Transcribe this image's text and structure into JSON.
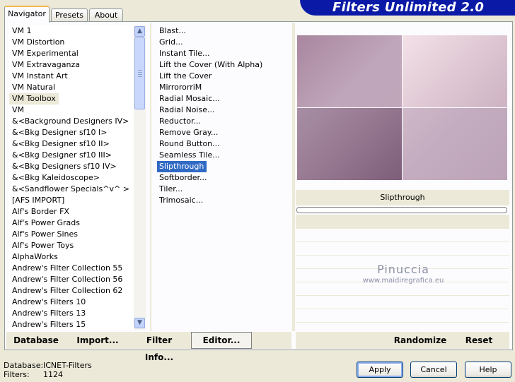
{
  "tabs": [
    "Navigator",
    "Presets",
    "About"
  ],
  "app_title": "Filters Unlimited 2.0",
  "categories": [
    "VM 1",
    "VM Distortion",
    "VM Experimental",
    "VM Extravaganza",
    "VM Instant Art",
    "VM Natural",
    "VM Toolbox",
    "VM",
    "&<Background Designers IV>",
    "&<Bkg Designer sf10 I>",
    "&<Bkg Designer sf10 II>",
    "&<Bkg Designer sf10 III>",
    "&<Bkg Designers sf10 IV>",
    "&<Bkg Kaleidoscope>",
    "&<Sandflower Specials^v^ >",
    "[AFS IMPORT]",
    "Alf's Border FX",
    "Alf's Power Grads",
    "Alf's Power Sines",
    "Alf's Power Toys",
    "AlphaWorks",
    "Andrew's Filter Collection 55",
    "Andrew's Filter Collection 56",
    "Andrew's Filter Collection 62",
    "Andrew's Filters 10",
    "Andrew's Filters 13",
    "Andrew's Filters 15"
  ],
  "filters": [
    "Blast...",
    "Grid...",
    "Instant Tile...",
    "Lift the Cover (With Alpha)",
    "Lift the Cover",
    "MirrororriM",
    "Radial Mosaic...",
    "Radial Noise...",
    "Reductor...",
    "Remove Gray...",
    "Round Button...",
    "Seamless Tile...",
    "Slipthrough",
    "Softborder...",
    "Tiler...",
    "Trimosaic..."
  ],
  "selected_filter": "Slipthrough",
  "progress_fraction": 0.0,
  "watermark": {
    "line1": "Pinuccia",
    "line2": "www.maidiregrafica.eu"
  },
  "toolbar": {
    "database": "Database",
    "import": "Import...",
    "filter_info": "Filter Info...",
    "editor": "Editor...",
    "randomize": "Randomize",
    "reset": "Reset"
  },
  "footer": {
    "database_label": "Database:",
    "database_value": "ICNET-Filters",
    "filters_label": "Filters:",
    "filters_value": "1124"
  },
  "buttons": {
    "apply": "Apply",
    "cancel": "Cancel",
    "help": "Help"
  },
  "colors": {
    "banner": "#0b1aa6",
    "selection": "#316ac5",
    "tab_highlight": "#f5b64b"
  }
}
